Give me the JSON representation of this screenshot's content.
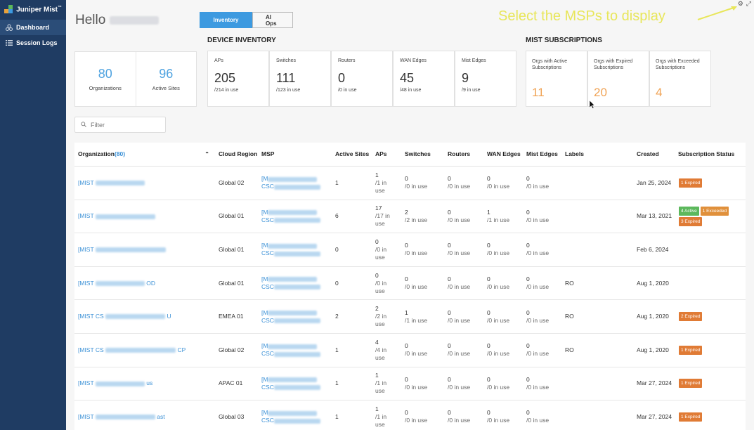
{
  "sidebar": {
    "brand": "Juniper Mist",
    "brand_tm": "™",
    "items": [
      {
        "label": "Dashboard",
        "icon": "dashboard-icon"
      },
      {
        "label": "Session Logs",
        "icon": "list-icon"
      }
    ]
  },
  "header": {
    "greeting": "Hello",
    "tabs": [
      {
        "label": "Inventory",
        "active": true
      },
      {
        "label": "AI Ops",
        "active": false
      }
    ]
  },
  "annotation": "Select the MSPs to display",
  "orgs_summary": [
    {
      "value": "80",
      "label": "Organizations"
    },
    {
      "value": "96",
      "label": "Active Sites"
    }
  ],
  "device_inventory": {
    "title": "DEVICE INVENTORY",
    "cards": [
      {
        "label": "APs",
        "value": "205",
        "sub": "/214 in use"
      },
      {
        "label": "Switches",
        "value": "111",
        "sub": "/123 in use"
      },
      {
        "label": "Routers",
        "value": "0",
        "sub": "/0 in use"
      },
      {
        "label": "WAN Edges",
        "value": "45",
        "sub": "/48 in use"
      },
      {
        "label": "Mist Edges",
        "value": "9",
        "sub": "/9 in use"
      }
    ]
  },
  "subscriptions": {
    "title": "MIST SUBSCRIPTIONS",
    "cards": [
      {
        "label": "Orgs with Active Subscriptions",
        "value": "11"
      },
      {
        "label": "Orgs with Expired Subscriptions",
        "value": "20"
      },
      {
        "label": "Orgs with Exceeded Subscriptions",
        "value": "4"
      }
    ]
  },
  "filter": {
    "placeholder": "Filter"
  },
  "table": {
    "headers": {
      "org": "Organization",
      "org_count": "(80)",
      "region": "Cloud Region",
      "msp": "MSP",
      "sites": "Active Sites",
      "aps": "APs",
      "switches": "Switches",
      "routers": "Routers",
      "wan": "WAN Edges",
      "mist": "Mist Edges",
      "labels": "Labels",
      "created": "Created",
      "status": "Subscription Status"
    },
    "rows": [
      {
        "org_prefix": "[MIST",
        "org_suffix": "",
        "region": "Global 02",
        "msp": "[M",
        "msp2": "CSC",
        "sites": "1",
        "aps": "1",
        "aps_sub": "/1 in use",
        "sw": "0",
        "sw_sub": "/0 in use",
        "rt": "0",
        "rt_sub": "/0 in use",
        "wan": "0",
        "wan_sub": "/0 in use",
        "mist": "0",
        "mist_sub": "/0 in use",
        "labels": "",
        "created": "Jan 25, 2024",
        "badges": [
          {
            "text": "1 Expired",
            "kind": "expired"
          }
        ]
      },
      {
        "org_prefix": "[MIST",
        "org_suffix": "",
        "region": "Global 01",
        "msp": "[M",
        "msp2": "CSC",
        "sites": "6",
        "aps": "17",
        "aps_sub": "/17 in use",
        "sw": "2",
        "sw_sub": "/2 in use",
        "rt": "0",
        "rt_sub": "/0 in use",
        "wan": "1",
        "wan_sub": "/1 in use",
        "mist": "0",
        "mist_sub": "/0 in use",
        "labels": "",
        "created": "Mar 13, 2021",
        "badges": [
          {
            "text": "4 Active",
            "kind": "active"
          },
          {
            "text": "1 Exceeded",
            "kind": "exceeded"
          },
          {
            "text": "3 Expired",
            "kind": "expired"
          }
        ]
      },
      {
        "org_prefix": "[MIST",
        "org_suffix": "",
        "region": "Global 01",
        "msp": "[M",
        "msp2": "CSC",
        "sites": "0",
        "aps": "0",
        "aps_sub": "/0 in use",
        "sw": "0",
        "sw_sub": "/0 in use",
        "rt": "0",
        "rt_sub": "/0 in use",
        "wan": "0",
        "wan_sub": "/0 in use",
        "mist": "0",
        "mist_sub": "/0 in use",
        "labels": "",
        "created": "Feb 6, 2024",
        "badges": []
      },
      {
        "org_prefix": "[MIST",
        "org_suffix": "OD",
        "region": "Global 01",
        "msp": "[M",
        "msp2": "CSC",
        "sites": "0",
        "aps": "0",
        "aps_sub": "/0 in use",
        "sw": "0",
        "sw_sub": "/0 in use",
        "rt": "0",
        "rt_sub": "/0 in use",
        "wan": "0",
        "wan_sub": "/0 in use",
        "mist": "0",
        "mist_sub": "/0 in use",
        "labels": "RO",
        "created": "Aug 1, 2020",
        "badges": []
      },
      {
        "org_prefix": "[MIST CS",
        "org_suffix": "U",
        "region": "EMEA 01",
        "msp": "[M",
        "msp2": "CSC",
        "sites": "2",
        "aps": "2",
        "aps_sub": "/2 in use",
        "sw": "1",
        "sw_sub": "/1 in use",
        "rt": "0",
        "rt_sub": "/0 in use",
        "wan": "0",
        "wan_sub": "/0 in use",
        "mist": "0",
        "mist_sub": "/0 in use",
        "labels": "RO",
        "created": "Aug 1, 2020",
        "badges": [
          {
            "text": "2 Expired",
            "kind": "expired"
          }
        ]
      },
      {
        "org_prefix": "[MIST CS",
        "org_suffix": "CP",
        "region": "Global 02",
        "msp": "[M",
        "msp2": "CSC",
        "sites": "1",
        "aps": "4",
        "aps_sub": "/4 in use",
        "sw": "0",
        "sw_sub": "/0 in use",
        "rt": "0",
        "rt_sub": "/0 in use",
        "wan": "0",
        "wan_sub": "/0 in use",
        "mist": "0",
        "mist_sub": "/0 in use",
        "labels": "RO",
        "created": "Aug 1, 2020",
        "badges": [
          {
            "text": "1 Expired",
            "kind": "expired"
          }
        ]
      },
      {
        "org_prefix": "[MIST",
        "org_suffix": "us",
        "region": "APAC 01",
        "msp": "[M",
        "msp2": "CSC",
        "sites": "1",
        "aps": "1",
        "aps_sub": "/1 in use",
        "sw": "0",
        "sw_sub": "/0 in use",
        "rt": "0",
        "rt_sub": "/0 in use",
        "wan": "0",
        "wan_sub": "/0 in use",
        "mist": "0",
        "mist_sub": "/0 in use",
        "labels": "",
        "created": "Mar 27, 2024",
        "badges": [
          {
            "text": "1 Expired",
            "kind": "expired"
          }
        ]
      },
      {
        "org_prefix": "[MIST",
        "org_suffix": "ast",
        "region": "Global 03",
        "msp": "[M",
        "msp2": "CSC",
        "sites": "1",
        "aps": "1",
        "aps_sub": "/1 in use",
        "sw": "0",
        "sw_sub": "/0 in use",
        "rt": "0",
        "rt_sub": "/0 in use",
        "wan": "0",
        "wan_sub": "/0 in use",
        "mist": "0",
        "mist_sub": "/0 in use",
        "labels": "",
        "created": "Mar 27, 2024",
        "badges": [
          {
            "text": "1 Expired",
            "kind": "expired"
          }
        ]
      }
    ]
  }
}
